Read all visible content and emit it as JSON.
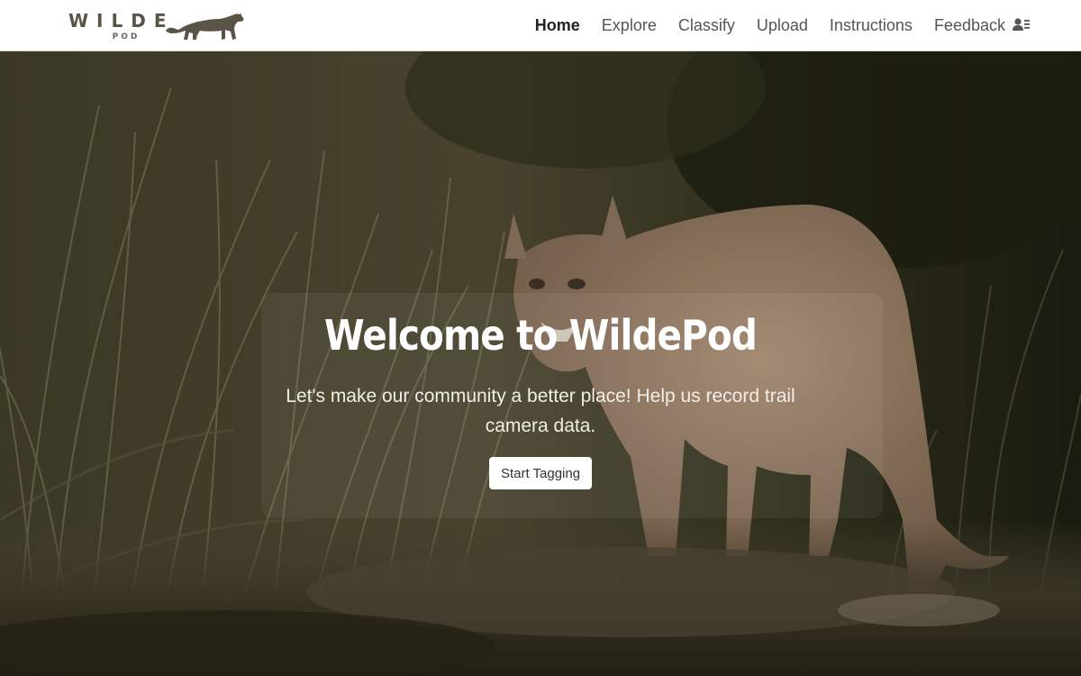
{
  "brand": {
    "word": "WILDE",
    "sub": "POD",
    "logo_icon": "cougar-logo-icon",
    "color": "#5a5348"
  },
  "nav": {
    "items": [
      {
        "label": "Home",
        "active": true
      },
      {
        "label": "Explore",
        "active": false
      },
      {
        "label": "Classify",
        "active": false
      },
      {
        "label": "Upload",
        "active": false
      },
      {
        "label": "Instructions",
        "active": false
      },
      {
        "label": "Feedback",
        "active": false
      }
    ],
    "account_icon": "user-list-icon"
  },
  "hero": {
    "title": "Welcome to WildePod",
    "subtitle": "Let's make our community a better place! Help us record trail camera data.",
    "cta_label": "Start Tagging",
    "background": "mountain-lion-in-grass-photo"
  }
}
